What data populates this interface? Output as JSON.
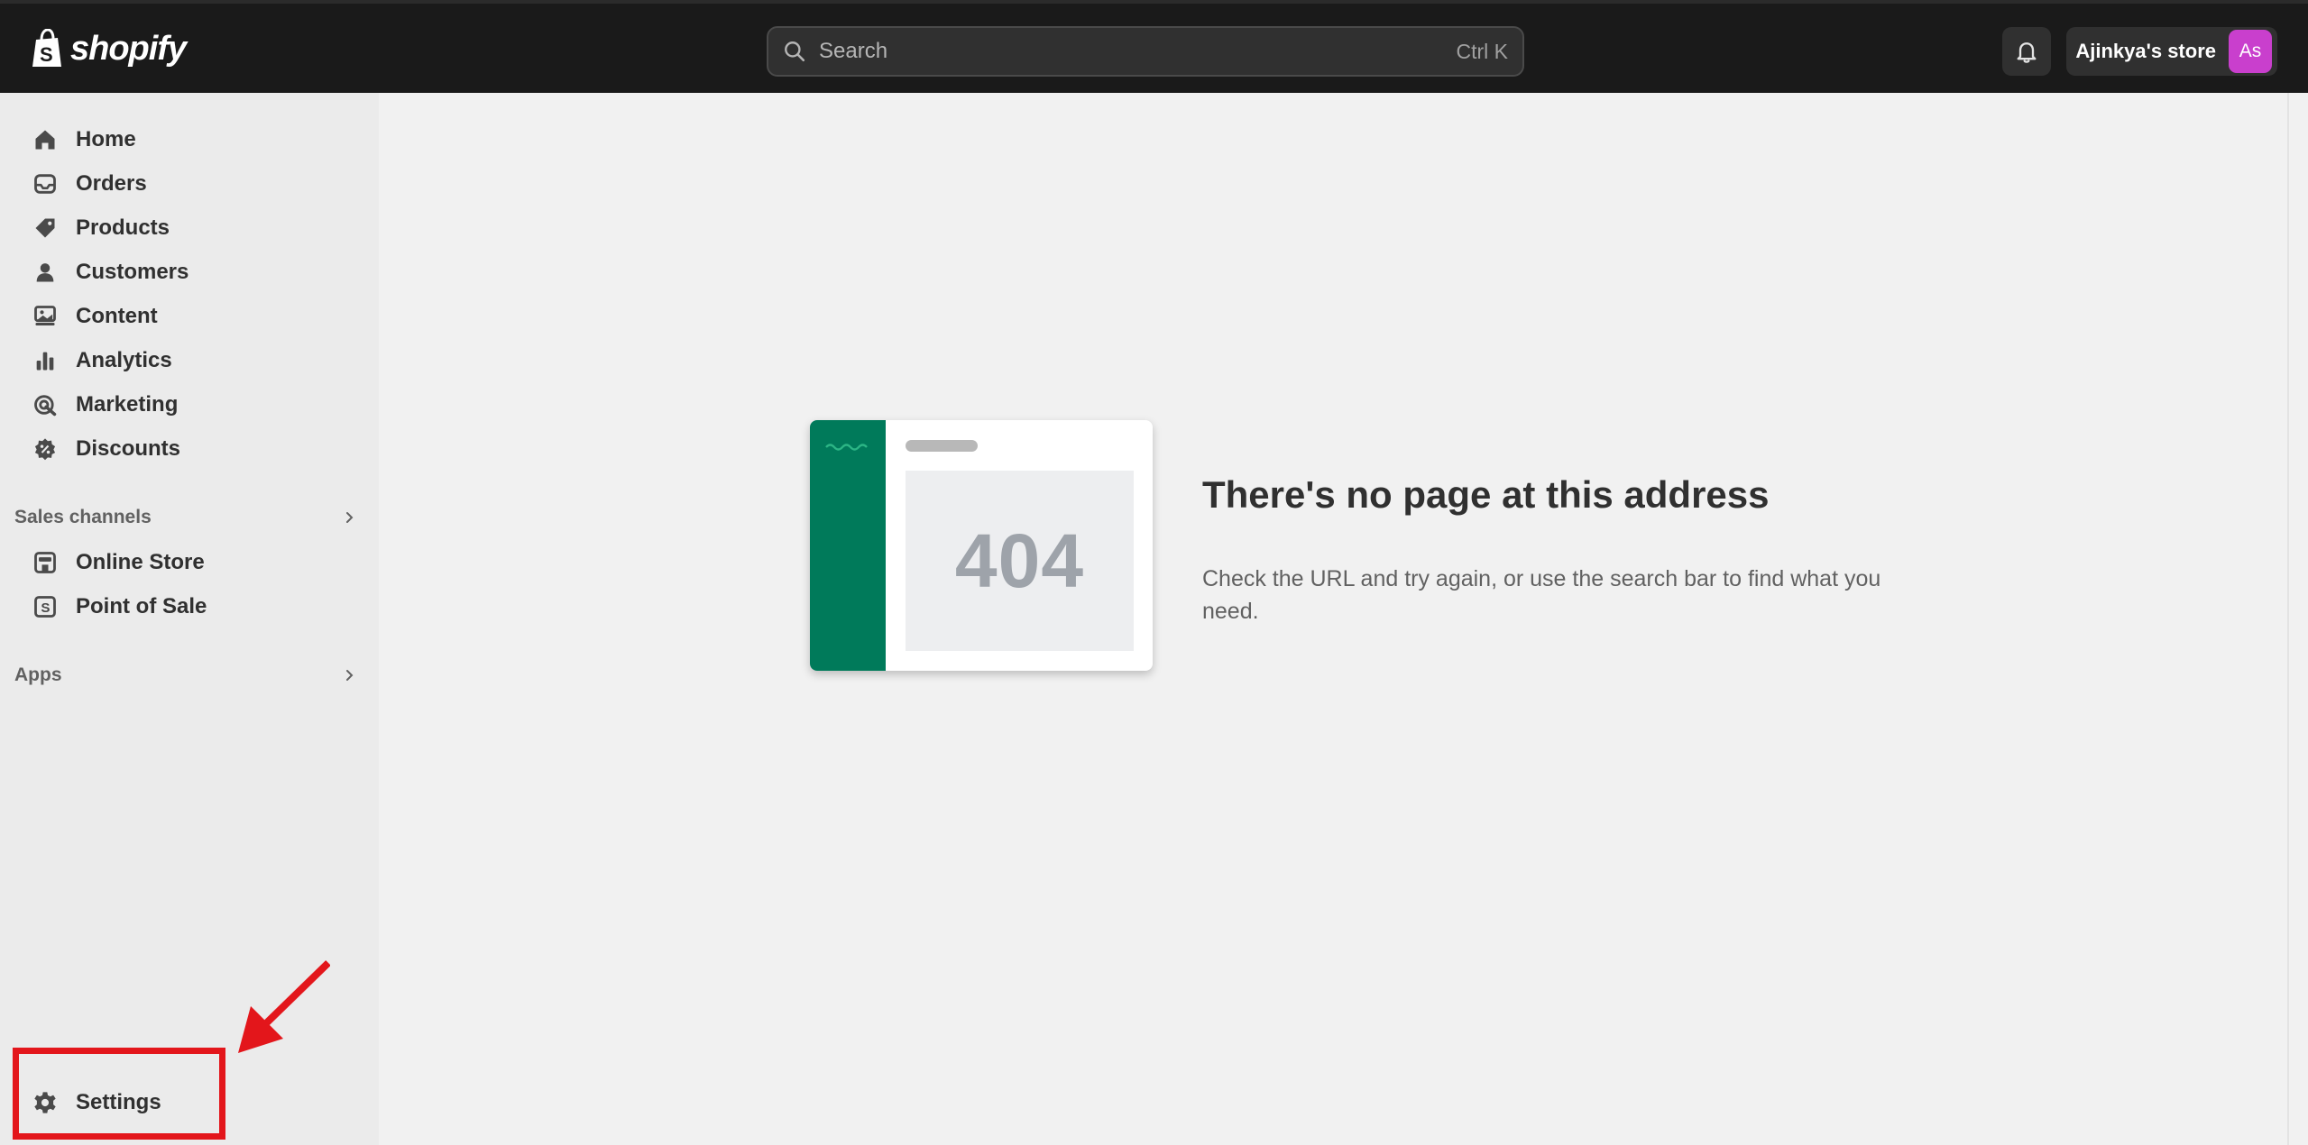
{
  "brand": {
    "name": "shopify"
  },
  "search": {
    "placeholder": "Search",
    "shortcut": "Ctrl K"
  },
  "account": {
    "store_name": "Ajinkya's store",
    "avatar_initials": "As",
    "avatar_color": "#c93fcd"
  },
  "sidebar": {
    "items": [
      {
        "label": "Home",
        "icon": "home-icon"
      },
      {
        "label": "Orders",
        "icon": "inbox-icon"
      },
      {
        "label": "Products",
        "icon": "tag-icon"
      },
      {
        "label": "Customers",
        "icon": "person-icon"
      },
      {
        "label": "Content",
        "icon": "image-icon"
      },
      {
        "label": "Analytics",
        "icon": "bar-chart-icon"
      },
      {
        "label": "Marketing",
        "icon": "target-icon"
      },
      {
        "label": "Discounts",
        "icon": "discount-icon"
      }
    ],
    "sales_channels": {
      "label": "Sales channels",
      "items": [
        {
          "label": "Online Store",
          "icon": "store-icon"
        },
        {
          "label": "Point of Sale",
          "icon": "pos-icon"
        }
      ]
    },
    "apps": {
      "label": "Apps"
    },
    "settings": {
      "label": "Settings",
      "icon": "gear-icon"
    }
  },
  "error": {
    "code": "404",
    "title": "There's no page at this address",
    "body": "Check the URL and try again, or use the search bar to find what you need."
  },
  "colors": {
    "topbar": "#1a1a1a",
    "accent_green": "#007a5a",
    "annotation_red": "#e3161b"
  }
}
